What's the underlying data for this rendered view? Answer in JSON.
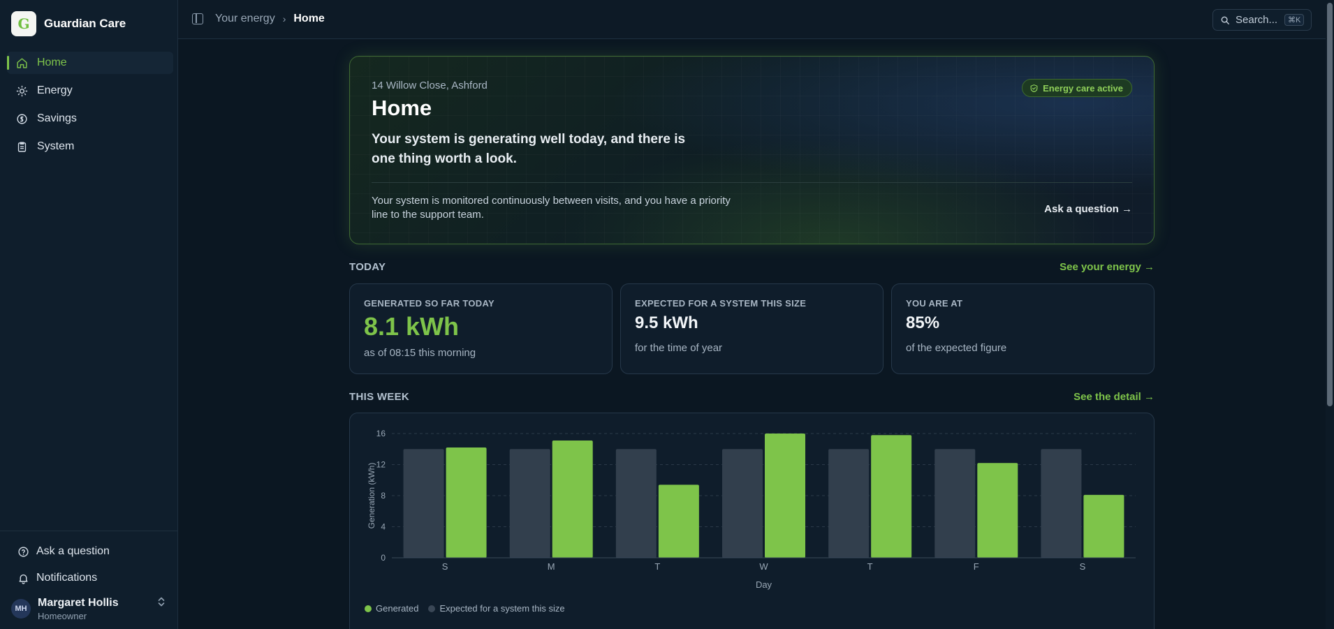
{
  "brand": {
    "name": "Guardian Care",
    "logo_letter": "G"
  },
  "nav": [
    {
      "label": "Home",
      "icon": "home-icon",
      "active": true
    },
    {
      "label": "Energy",
      "icon": "sun-icon",
      "active": false
    },
    {
      "label": "Savings",
      "icon": "coin-icon",
      "active": false
    },
    {
      "label": "System",
      "icon": "clipboard-icon",
      "active": false
    }
  ],
  "sidebar_bottom": {
    "ask": "Ask a question",
    "notifications": "Notifications"
  },
  "user": {
    "name": "Margaret Hollis",
    "role": "Homeowner",
    "initials": "MH"
  },
  "topbar": {
    "breadcrumb": [
      "Your energy",
      "Home"
    ],
    "search_label": "Search...",
    "search_shortcut": "⌘K"
  },
  "hero": {
    "address": "14 Willow Close, Ashford",
    "title": "Home",
    "lead": "Your system is generating well today, and there is one thing worth a look.",
    "badge": "Energy care active",
    "note": "Your system is monitored continuously between visits, and you have a priority line to the support team.",
    "ask_link": "Ask a question →"
  },
  "today": {
    "heading": "TODAY",
    "link": "See your energy →",
    "cards": [
      {
        "label": "GENERATED SO FAR TODAY",
        "value": "8.1 kWh",
        "sub": "as of 08:15 this morning"
      },
      {
        "label": "EXPECTED FOR A SYSTEM THIS SIZE",
        "value": "9.5 kWh",
        "sub": "for the time of year"
      },
      {
        "label": "YOU ARE AT",
        "value": "85%",
        "sub": "of the expected figure"
      }
    ]
  },
  "week": {
    "heading": "THIS WEEK",
    "link": "See the detail →"
  },
  "colors": {
    "accent": "#7ec44a",
    "expected_bar": "#323f4d",
    "background": "#0b1722"
  },
  "chart_data": {
    "type": "bar",
    "categories": [
      "S",
      "M",
      "T",
      "W",
      "T",
      "F",
      "S"
    ],
    "series": [
      {
        "name": "Expected for a system this size",
        "values": [
          14,
          14,
          14,
          14,
          14,
          14,
          14
        ],
        "color": "#323f4d"
      },
      {
        "name": "Generated",
        "values": [
          14.2,
          15.1,
          9.4,
          16,
          15.8,
          12.2,
          8.1
        ],
        "color": "#7ec44a"
      }
    ],
    "xlabel": "Day",
    "ylabel": "Generation (kWh)",
    "ylim": [
      0,
      16
    ],
    "yticks": [
      0,
      4,
      8,
      12,
      16
    ],
    "grid": true,
    "legend_position": "bottom-left",
    "legend": [
      "Generated",
      "Expected for a system this size"
    ]
  }
}
